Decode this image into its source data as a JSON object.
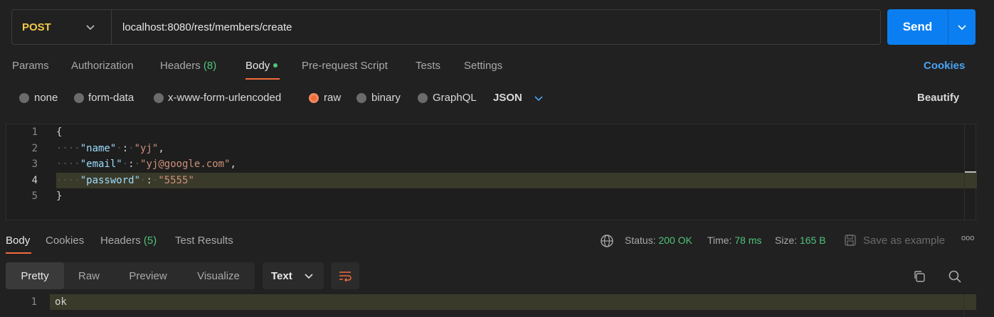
{
  "request": {
    "method": "POST",
    "url": "localhost:8080/rest/members/create",
    "send_label": "Send"
  },
  "tabs": [
    {
      "label": "Params"
    },
    {
      "label": "Authorization"
    },
    {
      "label": "Headers",
      "count": "(8)"
    },
    {
      "label": "Body"
    },
    {
      "label": "Pre-request Script"
    },
    {
      "label": "Tests"
    },
    {
      "label": "Settings"
    }
  ],
  "cookies_link": "Cookies",
  "body_types": [
    "none",
    "form-data",
    "x-www-form-urlencoded",
    "raw",
    "binary",
    "GraphQL"
  ],
  "body_type_selected": "raw",
  "format": "JSON",
  "beautify": "Beautify",
  "editor": {
    "line_numbers": [
      "1",
      "2",
      "3",
      "4",
      "5"
    ],
    "lines": {
      "l1": "{",
      "l2_key": "\"name\"",
      "l2_val": "\"yj\"",
      "l3_key": "\"email\"",
      "l3_val": "\"yj@google.com\"",
      "l4_key": "\"password\"",
      "l4_val": "\"5555\"",
      "l5": "}"
    },
    "colon": ":",
    "comma": ","
  },
  "response": {
    "tabs": [
      {
        "label": "Body"
      },
      {
        "label": "Cookies"
      },
      {
        "label": "Headers",
        "count": "(5)"
      },
      {
        "label": "Test Results"
      }
    ],
    "status_label": "Status:",
    "status_value": "200 OK",
    "time_label": "Time:",
    "time_value": "78 ms",
    "size_label": "Size:",
    "size_value": "165 B",
    "save_example": "Save as example",
    "more": "ooo",
    "views": [
      "Pretty",
      "Raw",
      "Preview",
      "Visualize"
    ],
    "view_format": "Text",
    "line_number": "1",
    "body": "ok"
  },
  "colors": {
    "accent": "#f26b3a",
    "send": "#0b7ff1",
    "method": "#f2c94c",
    "success": "#52c27a",
    "link": "#4aa3f3"
  }
}
